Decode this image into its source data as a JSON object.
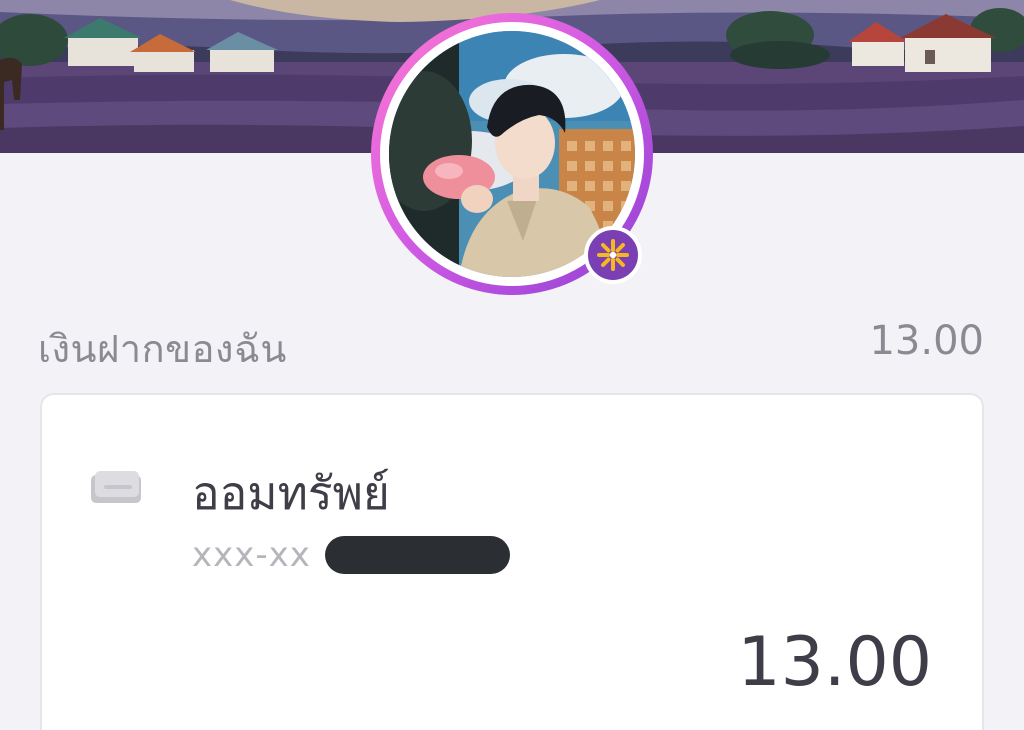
{
  "savings": {
    "title": "เงินฝากของฉัน",
    "total": "13.00"
  },
  "account": {
    "name": "ออมทรัพย์",
    "number_masked": "xxx-xx",
    "balance": "13.00"
  },
  "icons": {
    "avatar_badge": "sparkle-icon",
    "account": "card-icon"
  },
  "colors": {
    "avatar_ring_start": "#ff7ad0",
    "avatar_ring_end": "#8f3fd4",
    "badge": "#7b3fb4",
    "badge_sparkle": "#f6b81e"
  }
}
